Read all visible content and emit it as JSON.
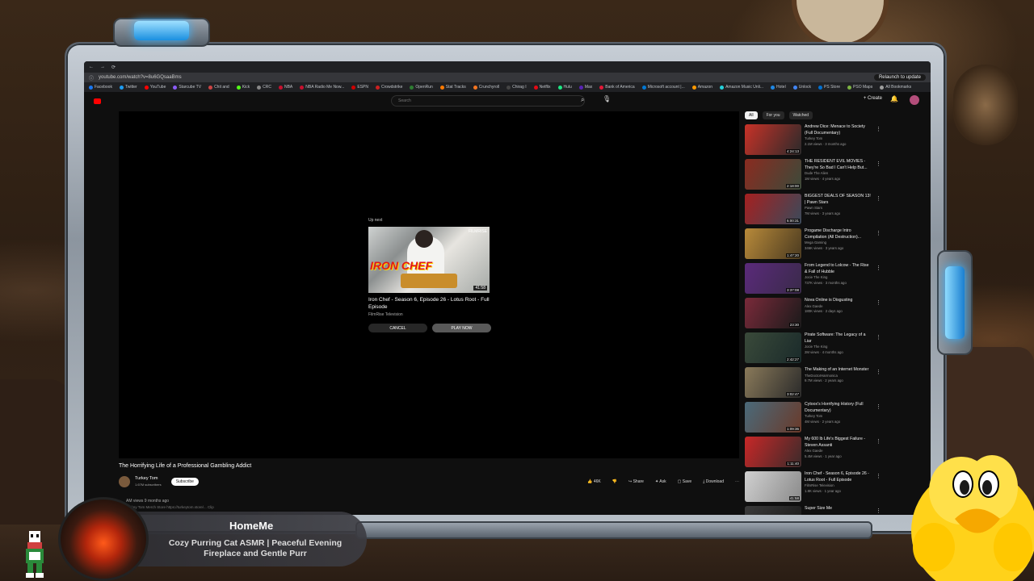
{
  "browser": {
    "url": "youtube.com/watch?v=8u6GQsaaBms",
    "relaunch_label": "Relaunch to update",
    "bookmarks": [
      {
        "label": "Facebook",
        "color": "#1877f2"
      },
      {
        "label": "Twitter",
        "color": "#1d9bf0"
      },
      {
        "label": "YouTube",
        "color": "#ff0000"
      },
      {
        "label": "Starcube TV",
        "color": "#8a5cf6"
      },
      {
        "label": "Chit and",
        "color": "#cc4444"
      },
      {
        "label": "Kick",
        "color": "#53fc18"
      },
      {
        "label": "CRC",
        "color": "#888888"
      },
      {
        "label": "NBA",
        "color": "#c8102e"
      },
      {
        "label": "NBA Radio Me Now...",
        "color": "#c8102e"
      },
      {
        "label": "ESPN",
        "color": "#d00000"
      },
      {
        "label": "Crowdstrike",
        "color": "#cc2020"
      },
      {
        "label": "OpenRun",
        "color": "#2e7d32"
      },
      {
        "label": "Stat Tracks",
        "color": "#ff7a00"
      },
      {
        "label": "Crunchyroll",
        "color": "#f47521"
      },
      {
        "label": "Chirag I",
        "color": "#444444"
      },
      {
        "label": "Netflix",
        "color": "#e50914"
      },
      {
        "label": "Hulu",
        "color": "#1ce783"
      },
      {
        "label": "Max",
        "color": "#5822b4"
      },
      {
        "label": "Bank of America",
        "color": "#e31837"
      },
      {
        "label": "Microsoft account |...",
        "color": "#0078d4"
      },
      {
        "label": "Amazon",
        "color": "#ff9900"
      },
      {
        "label": "Amazon Music Unli...",
        "color": "#25d1da"
      },
      {
        "label": "Hotel",
        "color": "#1e88e5"
      },
      {
        "label": "Unlock",
        "color": "#4285f4"
      },
      {
        "label": "PS Store",
        "color": "#0070d1"
      },
      {
        "label": "PSO Maps",
        "color": "#7cb342"
      },
      {
        "label": "All Bookmarks",
        "color": "#9e9e9e"
      }
    ]
  },
  "youtube": {
    "search_placeholder": "Search",
    "create_label": "Create",
    "upnext": {
      "label": "Up next",
      "title": "Iron Chef - Season 6, Episode 26 - Lotus Root - Full Episode",
      "channel": "FilmRise Television",
      "thumb_badge": "FILMRISE",
      "thumb_text": "IRON CHEF",
      "duration": "41:58",
      "cancel_label": "CANCEL",
      "play_label": "PLAY NOW"
    },
    "video": {
      "title": "The Horrifying Life of a Professional Gambling Addict",
      "channel": "Turkey Tom",
      "subscribers": "1.67M subscribers",
      "subscribe_label": "Subscribe",
      "likes": "46K",
      "share_label": "Share",
      "ask_label": "Ask",
      "save_label": "Save",
      "download_label": "Download",
      "views": "AM views  9 months ago",
      "desc": "Turkey Tom Merch Store https://turkeytom.store/...  Clip"
    },
    "chips": [
      "All",
      "For you",
      "Watched"
    ],
    "recommendations": [
      {
        "title": "Andrew Dice: Menace to Society (Full Documentary)",
        "channel": "Turkey Tom",
        "meta": "2.1M views · 3 months ago",
        "duration": "4:24:13",
        "colors": [
          "#c83228",
          "#2a2a2a"
        ]
      },
      {
        "title": "THE RESIDENT EVIL MOVIES - They're So Bad I Can't Help But...",
        "channel": "Dude The Alien",
        "meta": "1M views · 4 years ago",
        "duration": "2:18:00",
        "colors": [
          "#8a2b20",
          "#3c4a3a"
        ]
      },
      {
        "title": "BIGGEST DEALS OF SEASON 13! | Pawn Stars",
        "channel": "Pawn Stars",
        "meta": "7M views · 3 years ago",
        "duration": "5:00:31",
        "colors": [
          "#a52020",
          "#3a4a5a"
        ]
      },
      {
        "title": "Progame Discharge Intro Compilation (All Destruction)...",
        "channel": "Mega Gaming",
        "meta": "346K views · 3 years ago",
        "duration": "1:47:20",
        "colors": [
          "#b88a3a",
          "#4a3a20"
        ]
      },
      {
        "title": "From Legend to Lolcow - The Rise & Fall of Hubble",
        "channel": "Jocie The King",
        "meta": "737K views · 3 months ago",
        "duration": "3:37:08",
        "colors": [
          "#5a2a7a",
          "#3a2a4a"
        ]
      },
      {
        "title": "Nova Online is Disgusting",
        "channel": "Alex Gaede",
        "meta": "180K views · 2 days ago",
        "duration": "23:30",
        "colors": [
          "#7a2a3a",
          "#1a1a1a"
        ]
      },
      {
        "title": "Pirate Software: The Legacy of a Liar",
        "channel": "Jocie The King",
        "meta": "2M views · 4 months ago",
        "duration": "2:42:27",
        "colors": [
          "#3a4a3a",
          "#1a2a2a"
        ]
      },
      {
        "title": "The Making of an Internet Monster",
        "channel": "TheDoctorHarmonica",
        "meta": "9.7M views · 2 years ago",
        "duration": "3:02:47",
        "colors": [
          "#8a7a5a",
          "#2a2a2a"
        ]
      },
      {
        "title": "Cytoox's Horrifying History (Full Documentary)",
        "channel": "Turkey Tom",
        "meta": "4M views · 2 years ago",
        "duration": "1:09:36",
        "colors": [
          "#4a6a7a",
          "#6a3a2a"
        ]
      },
      {
        "title": "My 600 lb Life's Biggest Failure - Steven Assanti",
        "channel": "Alex Gaede",
        "meta": "5.4M views · 1 year ago",
        "duration": "1:11:40",
        "colors": [
          "#c82828",
          "#3a2a2a"
        ]
      },
      {
        "title": "Iron Chef - Season 6, Episode 26 - Lotus Root - Full Episode",
        "channel": "FilmRise Television",
        "meta": "1.8K views · 1 year ago",
        "duration": "41:58",
        "colors": [
          "#d0d0d0",
          "#8a8a8a"
        ]
      },
      {
        "title": "Super Size Me",
        "channel": "",
        "meta": "",
        "duration": "",
        "colors": [
          "#3a3a3a",
          "#1a1a1a"
        ]
      }
    ]
  },
  "overlay": {
    "name": "HomeMe",
    "subtitle": "Cozy Purring Cat ASMR | Peaceful Evening Fireplace and Gentle Purr"
  },
  "colors": {
    "frame_glow": "#3cb4ff",
    "youtube_red": "#ff0000",
    "chick_yellow": "#ffd21a"
  }
}
